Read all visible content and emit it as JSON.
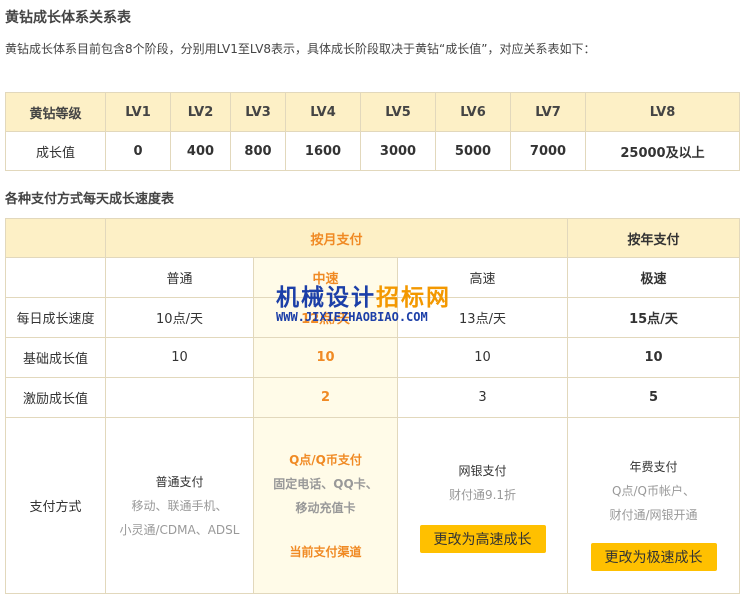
{
  "title": "黄钻成长体系关系表",
  "intro": "黄钻成长体系目前包含8个阶段，分别用LV1至LV8表示，具体成长阶段取决于黄钻“成长值”，对应关系表如下：",
  "level_table": {
    "header_label": "黄钻等级",
    "levels": [
      "LV1",
      "LV2",
      "LV3",
      "LV4",
      "LV5",
      "LV6",
      "LV7",
      "LV8"
    ],
    "value_label": "成长值",
    "values": [
      "0",
      "400",
      "800",
      "1600",
      "3000",
      "5000",
      "7000",
      "25000及以上"
    ]
  },
  "speed_title": "各种支付方式每天成长速度表",
  "speed_table": {
    "monthly": "按月支付",
    "yearly": "按年支付",
    "tiers": [
      "普通",
      "中速",
      "高速",
      "极速"
    ],
    "rows": [
      {
        "label": "每日成长速度",
        "cells": [
          "10点/天",
          "12点/天",
          "13点/天",
          "15点/天"
        ]
      },
      {
        "label": "基础成长值",
        "cells": [
          "10",
          "10",
          "10",
          "10"
        ]
      },
      {
        "label": "激励成长值",
        "cells": [
          "",
          "2",
          "3",
          "5"
        ]
      }
    ],
    "payment_label": "支付方式",
    "normal": {
      "title": "普通支付",
      "line1": "移动、联通手机、",
      "line2": "小灵通/CDMA、ADSL"
    },
    "medium": {
      "title": "Q点/Q币支付",
      "line1": "固定电话、QQ卡、",
      "line2": "移动充值卡",
      "current": "当前支付渠道"
    },
    "fast": {
      "title": "网银支付",
      "line1": "财付通9.1折",
      "button": "更改为高速成长"
    },
    "extreme": {
      "title": "年费支付",
      "line1": "Q点/Q币帐户、",
      "line2": "财付通/网银开通",
      "button": "更改为极速成长"
    }
  },
  "watermark": {
    "part1": "机械设计",
    "part2": "招标网",
    "url": "WWW.JIXIEZHAOBIAO.COM"
  }
}
